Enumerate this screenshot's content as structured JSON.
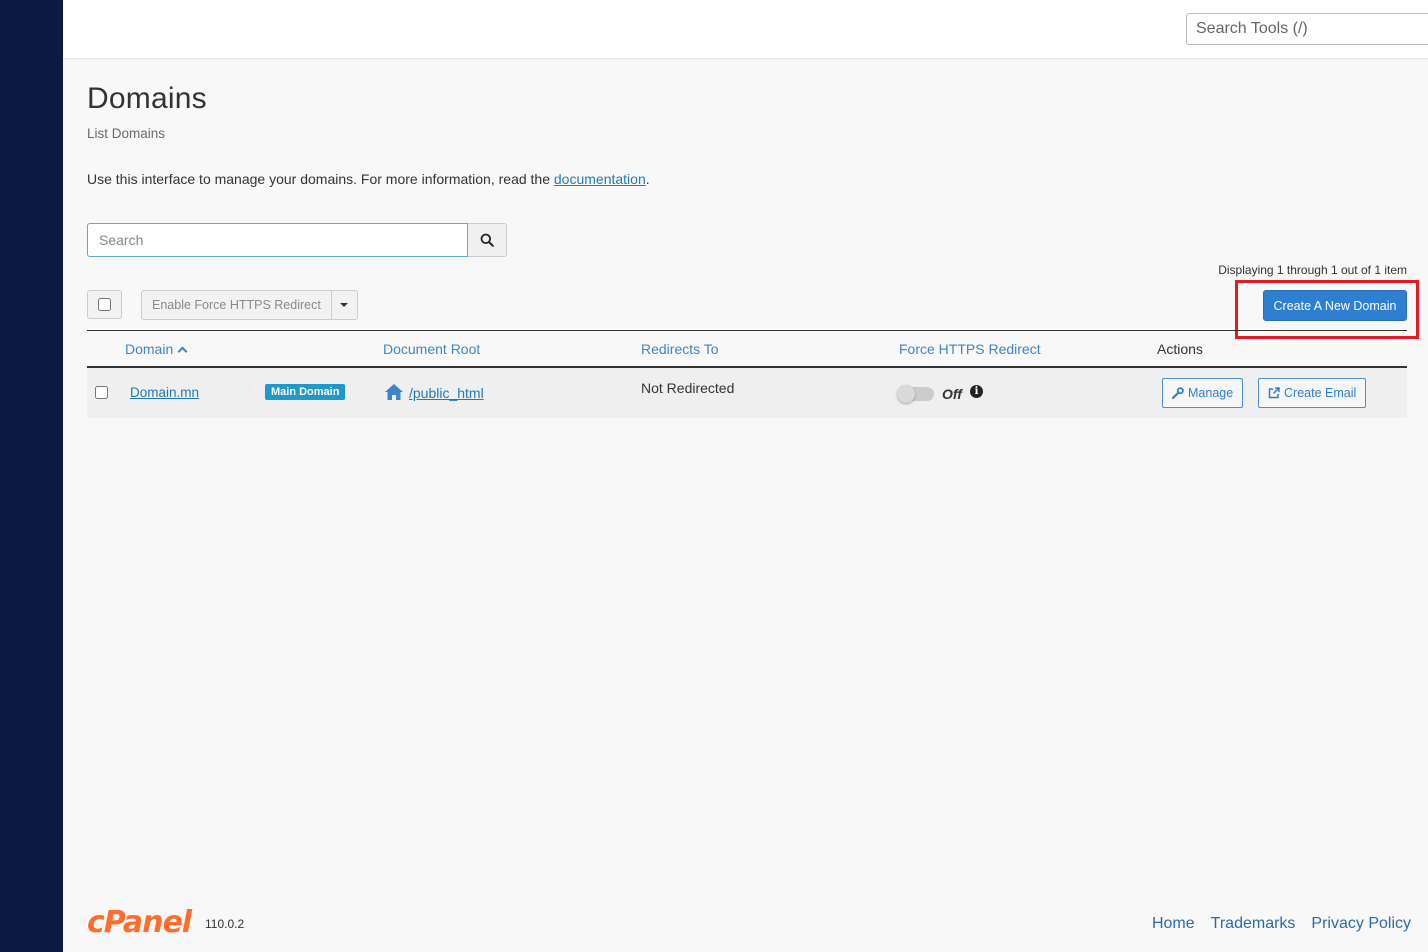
{
  "topbar": {
    "search_placeholder": "Search Tools (/)"
  },
  "page": {
    "title": "Domains",
    "subtitle": "List Domains",
    "intro_text": "Use this interface to manage your domains. For more information, read the ",
    "intro_link": "documentation",
    "intro_end": "."
  },
  "search": {
    "placeholder": "Search"
  },
  "toolbar": {
    "display_count": "Displaying 1 through 1 out of 1 item",
    "https_button": "Enable Force HTTPS Redirect",
    "create_button": "Create A New Domain"
  },
  "table": {
    "headers": {
      "domain": "Domain",
      "document_root": "Document Root",
      "redirects_to": "Redirects To",
      "force_https": "Force HTTPS Redirect",
      "actions": "Actions"
    },
    "rows": [
      {
        "domain": "Domain.mn",
        "badge": "Main Domain",
        "document_root": "/public_html",
        "redirects_to": "Not Redirected",
        "https_status": "Off",
        "manage_label": "Manage",
        "create_email_label": "Create Email"
      }
    ]
  },
  "footer": {
    "logo": "cPanel",
    "version": "110.0.2",
    "links": [
      "Home",
      "Trademarks",
      "Privacy Policy"
    ]
  },
  "colors": {
    "sidebar": "#0b1a42",
    "link": "#1f7ab5",
    "primary": "#2e7fd1",
    "highlight": "#e01b24",
    "badge": "#1f99c9",
    "logo": "#ff6c2c"
  }
}
